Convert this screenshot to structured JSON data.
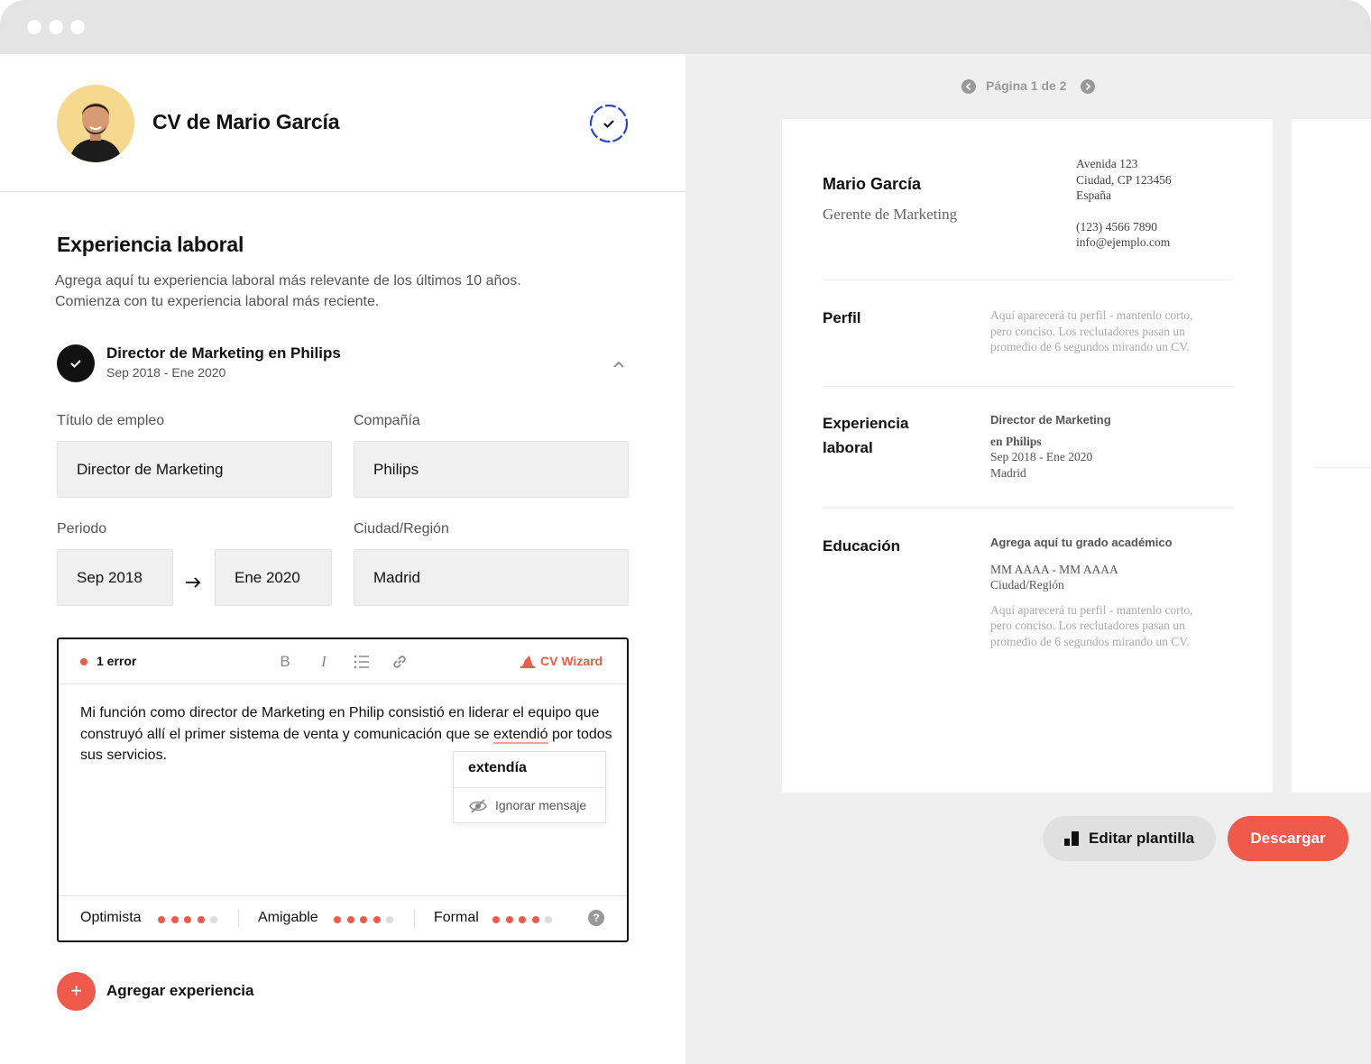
{
  "header": {
    "cv_title": "CV de Mario García"
  },
  "section": {
    "title": "Experiencia laboral",
    "desc_line1": "Agrega aquí tu experiencia laboral más relevante de los últimos 10 años.",
    "desc_line2": "Comienza con tu experiencia laboral más reciente."
  },
  "job": {
    "title": "Director de Marketing en Philips",
    "dates": "Sep 2018 - Ene 2020"
  },
  "form": {
    "job_title_label": "Título de empleo",
    "job_title_value": "Director de Marketing",
    "company_label": "Compañía",
    "company_value": "Philips",
    "period_label": "Periodo",
    "start_value": "Sep 2018",
    "end_value": "Ene 2020",
    "city_label": "Ciudad/Región",
    "city_value": "Madrid"
  },
  "editor": {
    "error_count": "1 error",
    "bold": "B",
    "italic": "I",
    "wizard": "CV Wizard",
    "text_before": "Mi función como director de Marketing en Philip consistió en liderar el equipo que construyó allí el primer sistema de venta y comunicación que se ",
    "misspelled": "extendió",
    "text_after": " por todos sus servicios.",
    "suggestion": "extendía",
    "ignore": "Ignorar mensaje",
    "tones": [
      {
        "label": "Optimista",
        "level": 4,
        "max": 5
      },
      {
        "label": "Amigable",
        "level": 4,
        "max": 5
      },
      {
        "label": "Formal",
        "level": 4,
        "max": 5
      }
    ],
    "help": "?"
  },
  "add_experience": "Agregar experiencia",
  "preview": {
    "pager": "Página 1 de 2",
    "name": "Mario García",
    "role": "Gerente de Marketing",
    "address1": "Avenida 123",
    "address2": "Ciudad, CP 123456",
    "address3": "España",
    "phone": "(123) 4566 7890",
    "email": "info@ejemplo.com",
    "profile_title": "Perfil",
    "profile_text1": "Aquí aparecerá tu perfil - mantenlo corto,",
    "profile_text2": "pero conciso. Los reclutadores pasan un",
    "profile_text3": "promedio de 6 segundos mirando un CV.",
    "exp_title1": "Experiencia",
    "exp_title2": "laboral",
    "exp_job": "Director de Marketing",
    "exp_company": "en Philips",
    "exp_dates": "Sep 2018 - Ene 2020",
    "exp_city": "Madrid",
    "edu_title": "Educación",
    "edu_degree": "Agrega aquí tu grado académico",
    "edu_dates": "MM AAAA - MM AAAA",
    "edu_city": "Ciudad/Región",
    "edu_text1": "Aquí aparecerá tu perfil - mantenlo corto,",
    "edu_text2": "pero conciso. Los reclutadores pasan un",
    "edu_text3": "promedio de 6 segundos mirando un CV."
  },
  "actions": {
    "edit_template": "Editar plantilla",
    "download": "Descargar"
  },
  "colors": {
    "accent": "#ef5a4a",
    "progress": "#2d46c9",
    "avatar_bg": "#f6d98d"
  }
}
